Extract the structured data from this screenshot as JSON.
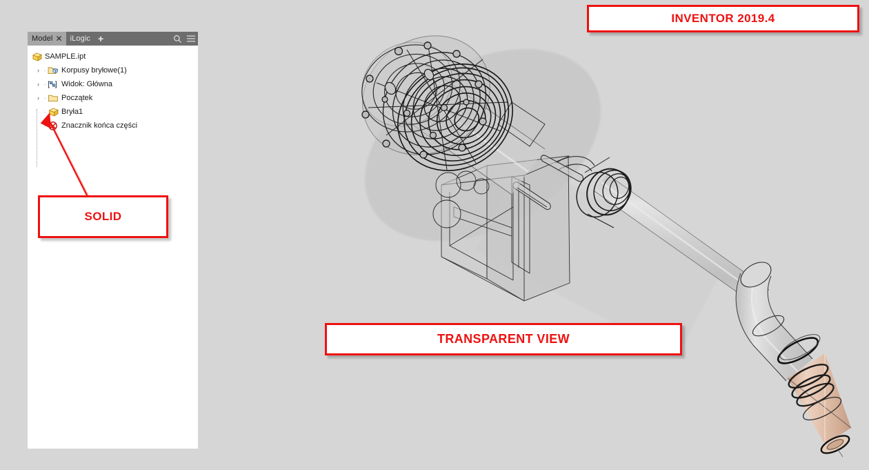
{
  "app": {
    "background_color": "#d6d6d6",
    "annotation_color": "#ee1111"
  },
  "browser": {
    "tabs": [
      {
        "label": "Model",
        "active": true,
        "close_icon": "close-icon"
      },
      {
        "label": "iLogic",
        "active": false
      }
    ],
    "add_tab_label": "+",
    "close_label": "✕",
    "tools": [
      {
        "name": "search-icon"
      },
      {
        "name": "menu-icon"
      }
    ],
    "tree": [
      {
        "label": "SAMPLE.ipt",
        "icon": "part-cube-icon",
        "expander": "",
        "level": 0
      },
      {
        "label": "Korpusy bryłowe(1)",
        "icon": "solid-bodies-folder-icon",
        "expander": "›",
        "level": 1
      },
      {
        "label": "Widok: Główna",
        "icon": "view-icon",
        "expander": "›",
        "level": 1
      },
      {
        "label": "Początek",
        "icon": "origin-folder-icon",
        "expander": "›",
        "level": 1
      },
      {
        "label": "Bryła1",
        "icon": "solid-cube-icon",
        "expander": "",
        "level": 1
      },
      {
        "label": "Znacznik końca części",
        "icon": "end-of-part-icon",
        "expander": "",
        "level": 1
      }
    ]
  },
  "callouts": {
    "inventor": "INVENTOR 2019.4",
    "transparent": "TRANSPARENT VIEW",
    "solid": "SOLID"
  },
  "model": {
    "display_mode": "transparent-wireframe",
    "body_color": "#c9c9c9",
    "nozzle_tip_color": "#e0c0ab",
    "edge_color": "#2b2b2b"
  }
}
